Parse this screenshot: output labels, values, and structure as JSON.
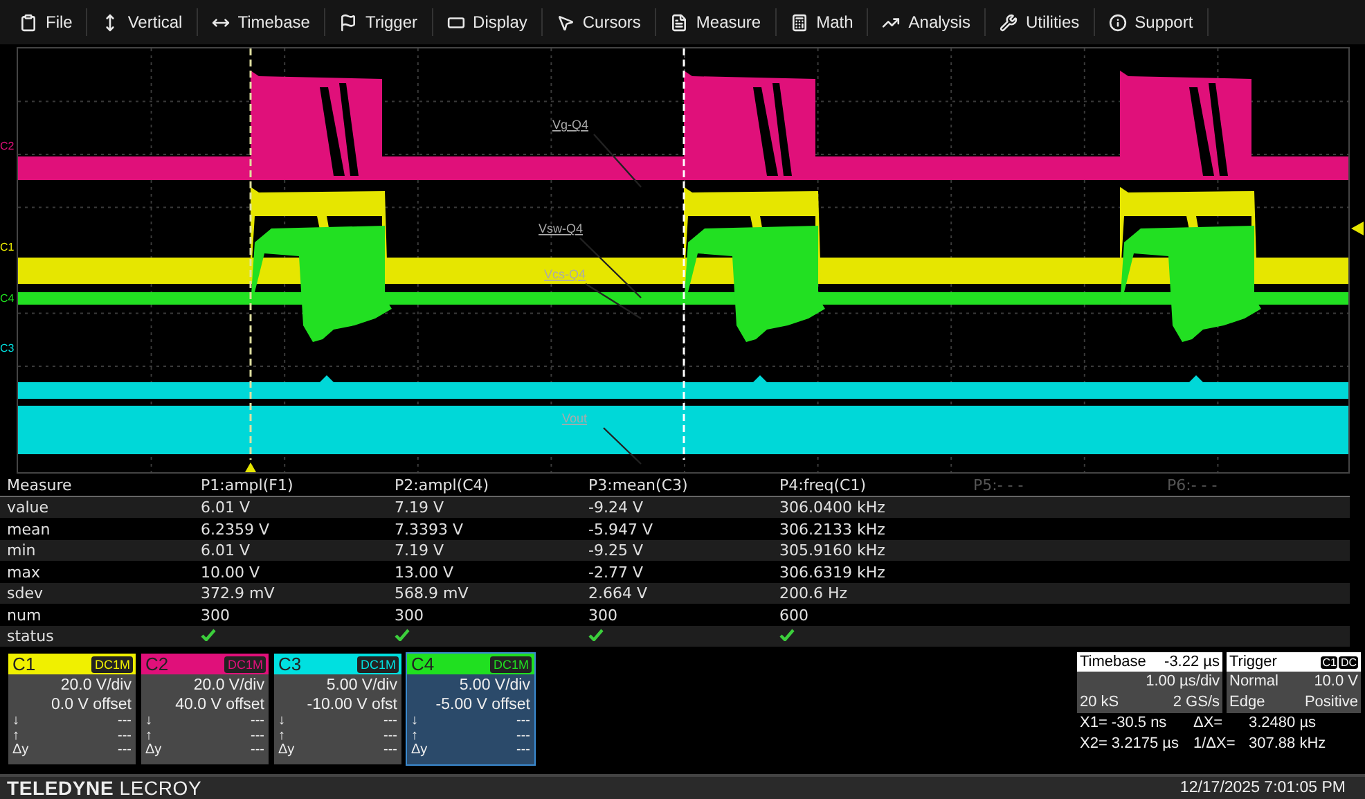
{
  "menu": [
    {
      "label": "File"
    },
    {
      "label": "Vertical"
    },
    {
      "label": "Timebase"
    },
    {
      "label": "Trigger"
    },
    {
      "label": "Display"
    },
    {
      "label": "Cursors"
    },
    {
      "label": "Measure"
    },
    {
      "label": "Math"
    },
    {
      "label": "Analysis"
    },
    {
      "label": "Utilities"
    },
    {
      "label": "Support"
    }
  ],
  "display": {
    "channel_markers": [
      {
        "label": "C2",
        "color": "#e0107a"
      },
      {
        "label": "C1",
        "color": "#f0f000"
      },
      {
        "label": "C4",
        "color": "#20e020"
      },
      {
        "label": "C3",
        "color": "#00e0e0"
      }
    ],
    "trace_labels": [
      {
        "text": "Vg-Q4"
      },
      {
        "text": "Vsw-Q4"
      },
      {
        "text": "Vcs-Q4"
      },
      {
        "text": "Vout"
      }
    ]
  },
  "measure": {
    "columns": [
      {
        "label": "Measure",
        "disabled": false
      },
      {
        "label": "P1:ampl(F1)",
        "disabled": false
      },
      {
        "label": "P2:ampl(C4)",
        "disabled": false
      },
      {
        "label": "P3:mean(C3)",
        "disabled": false
      },
      {
        "label": "P4:freq(C1)",
        "disabled": false
      },
      {
        "label": "P5:- - -",
        "disabled": true
      },
      {
        "label": "P6:- - -",
        "disabled": true
      }
    ],
    "rows": [
      {
        "cells": [
          "value",
          "6.01 V",
          "7.19 V",
          "-9.24 V",
          "306.0400 kHz"
        ]
      },
      {
        "cells": [
          "mean",
          "6.2359 V",
          "7.3393 V",
          "-5.947 V",
          "306.2133 kHz"
        ]
      },
      {
        "cells": [
          "min",
          "6.01 V",
          "7.19 V",
          "-9.25 V",
          "305.9160 kHz"
        ]
      },
      {
        "cells": [
          "max",
          "10.00 V",
          "13.00 V",
          "-2.77 V",
          "306.6319 kHz"
        ]
      },
      {
        "cells": [
          "sdev",
          "372.9 mV",
          "568.9 mV",
          "2.664 V",
          "200.6 Hz"
        ]
      },
      {
        "cells": [
          "num",
          "300",
          "300",
          "300",
          "600"
        ]
      }
    ],
    "status": {
      "label": "status",
      "checks": [
        true,
        true,
        true,
        true
      ]
    }
  },
  "channels": [
    {
      "name": "C1",
      "coupling": "DC1M",
      "vdiv": "20.0 V/div",
      "offset": "0.0 V offset",
      "color": "#f0f000",
      "selected": false,
      "readouts": [
        {
          "label": "↓",
          "value": "---"
        },
        {
          "label": "↑",
          "value": "---"
        },
        {
          "label": "Δy",
          "value": "---"
        }
      ]
    },
    {
      "name": "C2",
      "coupling": "DC1M",
      "vdiv": "20.0 V/div",
      "offset": "40.0 V offset",
      "color": "#e0107a",
      "selected": false,
      "readouts": [
        {
          "label": "↓",
          "value": "---"
        },
        {
          "label": "↑",
          "value": "---"
        },
        {
          "label": "Δy",
          "value": "---"
        }
      ]
    },
    {
      "name": "C3",
      "coupling": "DC1M",
      "vdiv": "5.00 V/div",
      "offset": "-10.00 V ofst",
      "color": "#00e0e0",
      "selected": false,
      "readouts": [
        {
          "label": "↓",
          "value": "---"
        },
        {
          "label": "↑",
          "value": "---"
        },
        {
          "label": "Δy",
          "value": "---"
        }
      ]
    },
    {
      "name": "C4",
      "coupling": "DC1M",
      "vdiv": "5.00 V/div",
      "offset": "-5.00 V offset",
      "color": "#20e020",
      "selected": true,
      "readouts": [
        {
          "label": "↓",
          "value": "---"
        },
        {
          "label": "↑",
          "value": "---"
        },
        {
          "label": "Δy",
          "value": "---"
        }
      ]
    }
  ],
  "timebase": {
    "title": "Timebase",
    "delay": "-3.22 µs",
    "scale": "1.00 µs/div",
    "samples": "20 kS",
    "rate": "2 GS/s"
  },
  "trigger": {
    "title": "Trigger",
    "source": "C1",
    "coupling": "DC",
    "mode": "Normal",
    "level": "10.0 V",
    "type": "Edge",
    "slope": "Positive"
  },
  "cursors": [
    [
      "X1= -30.5 ns",
      "ΔX=",
      "3.2480 µs"
    ],
    [
      "X2= 3.2175 µs",
      "1/ΔX=",
      "307.88 kHz"
    ]
  ],
  "footer": {
    "brand": "**TELEDYNE** LECROY",
    "datetime": "12/17/2025 7:01:05 PM"
  }
}
